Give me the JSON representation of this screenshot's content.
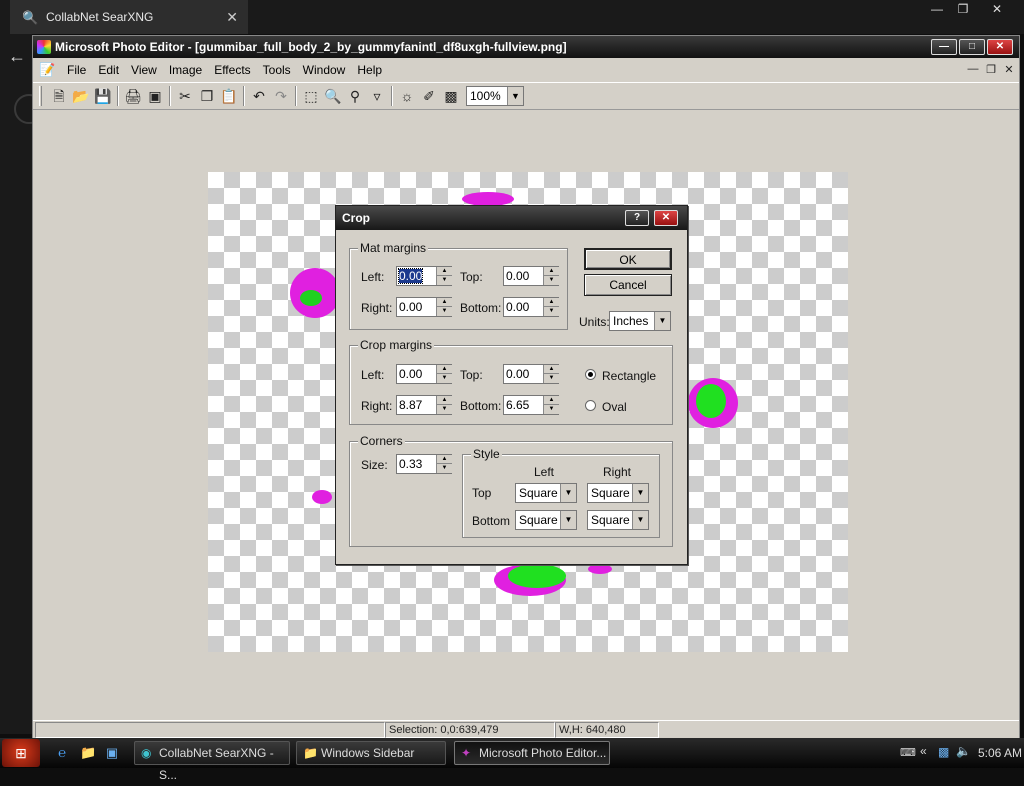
{
  "browser": {
    "tab_title": "CollabNet SearXNG",
    "tab_close": "✕",
    "back": "←",
    "win_controls": [
      "—",
      "❐",
      "✕"
    ]
  },
  "app": {
    "title": "Microsoft Photo Editor - [gummibar_full_body_2_by_gummyfanintl_df8uxgh-fullview.png]",
    "menu": [
      "File",
      "Edit",
      "View",
      "Image",
      "Effects",
      "Tools",
      "Window",
      "Help"
    ],
    "zoom": "100%",
    "status": {
      "selection": "Selection: 0,0:639,479",
      "size": "W,H: 640,480"
    }
  },
  "crop_dialog": {
    "title": "Crop",
    "help": "?",
    "close": "✕",
    "mat_margins": {
      "label": "Mat margins",
      "left_label": "Left:",
      "left": "0.00",
      "top_label": "Top:",
      "top": "0.00",
      "right_label": "Right:",
      "right": "0.00",
      "bottom_label": "Bottom:",
      "bottom": "0.00"
    },
    "crop_margins": {
      "label": "Crop margins",
      "left_label": "Left:",
      "left": "0.00",
      "top_label": "Top:",
      "top": "0.00",
      "right_label": "Right:",
      "right": "8.87",
      "bottom_label": "Bottom:",
      "bottom": "6.65",
      "shape_rectangle": "Rectangle",
      "shape_oval": "Oval",
      "selected_shape": "Rectangle"
    },
    "corners": {
      "label": "Corners",
      "size_label": "Size:",
      "size": "0.33",
      "style_label": "Style",
      "col_left": "Left",
      "col_right": "Right",
      "row_top": "Top",
      "row_bottom": "Bottom",
      "top_left": "Square",
      "top_right": "Square",
      "bottom_left": "Square",
      "bottom_right": "Square"
    },
    "ok": "OK",
    "cancel": "Cancel",
    "units_label": "Units:",
    "units": "Inches"
  },
  "taskbar": {
    "tasks": [
      {
        "label": "CollabNet SearXNG - S...",
        "icon": "browser-icon"
      },
      {
        "label": "Windows Sidebar",
        "icon": "folder-icon"
      },
      {
        "label": "Microsoft Photo Editor...",
        "icon": "photo-editor-icon"
      }
    ],
    "clock": "5:06 AM"
  },
  "colors": {
    "accent_magenta": "#e020e0",
    "accent_green": "#20e020",
    "title_dark": "#1a1a1a"
  }
}
